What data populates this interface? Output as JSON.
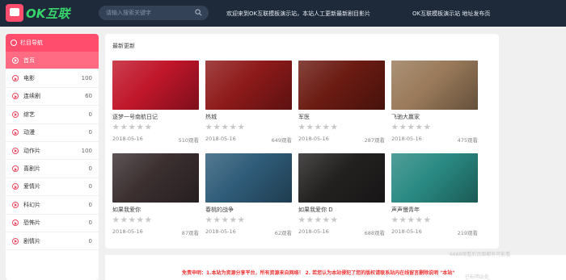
{
  "header": {
    "logo_text": "OK互联",
    "search_placeholder": "请输入搜索关键字",
    "welcome": "欢迎来到OK互联模板演示站，本站人工更新最新剧目影片",
    "demo_notice": "OK互联模板演示站 地址发布页"
  },
  "sidebar": {
    "title": "栏目导航",
    "items": [
      {
        "label": "首页",
        "count": "",
        "active": true
      },
      {
        "label": "电影",
        "count": "100"
      },
      {
        "label": "连续剧",
        "count": "60"
      },
      {
        "label": "综艺",
        "count": "0"
      },
      {
        "label": "动漫",
        "count": "0"
      },
      {
        "label": "动作片",
        "count": "100"
      },
      {
        "label": "喜剧片",
        "count": "0"
      },
      {
        "label": "爱情片",
        "count": "0"
      },
      {
        "label": "科幻片",
        "count": "0"
      },
      {
        "label": "恐怖片",
        "count": "0"
      },
      {
        "label": "剧情片",
        "count": "0"
      }
    ]
  },
  "main": {
    "section_title": "最新更新",
    "cards": [
      {
        "title": "逐梦一号南航日记",
        "date": "2018-05-16",
        "views": "510观看",
        "color": "#c0162a"
      },
      {
        "title": "热城",
        "date": "2018-05-16",
        "views": "649观看",
        "color": "#8e1a1a"
      },
      {
        "title": "军医",
        "date": "2018-05-16",
        "views": "287观看",
        "color": "#6b1b12"
      },
      {
        "title": "飞驰大赢家",
        "date": "2018-05-16",
        "views": "475观看",
        "color": "#9a7a5a"
      },
      {
        "title": "如果我爱你",
        "date": "2018-05-16",
        "views": "87观看",
        "color": "#3b2f30"
      },
      {
        "title": "春桃的战争",
        "date": "2018-05-16",
        "views": "62观看",
        "color": "#2f5c79"
      },
      {
        "title": "如果我爱你 D",
        "date": "2018-05-16",
        "views": "688观看",
        "color": "#232020"
      },
      {
        "title": "声声慢青年",
        "date": "2018-05-16",
        "views": "219观看",
        "color": "#2a8a83"
      }
    ]
  },
  "footer": {
    "notice": "免责申明：1.本站为资源分享平台，所有资源来自网络！ 2. 若您认为本站侵犯了您的版权请联系站内在线留言删除说明 \"本站\"",
    "ghost_1": "6688观看后页面都有可能看",
    "ghost_2": "已标明出处"
  }
}
